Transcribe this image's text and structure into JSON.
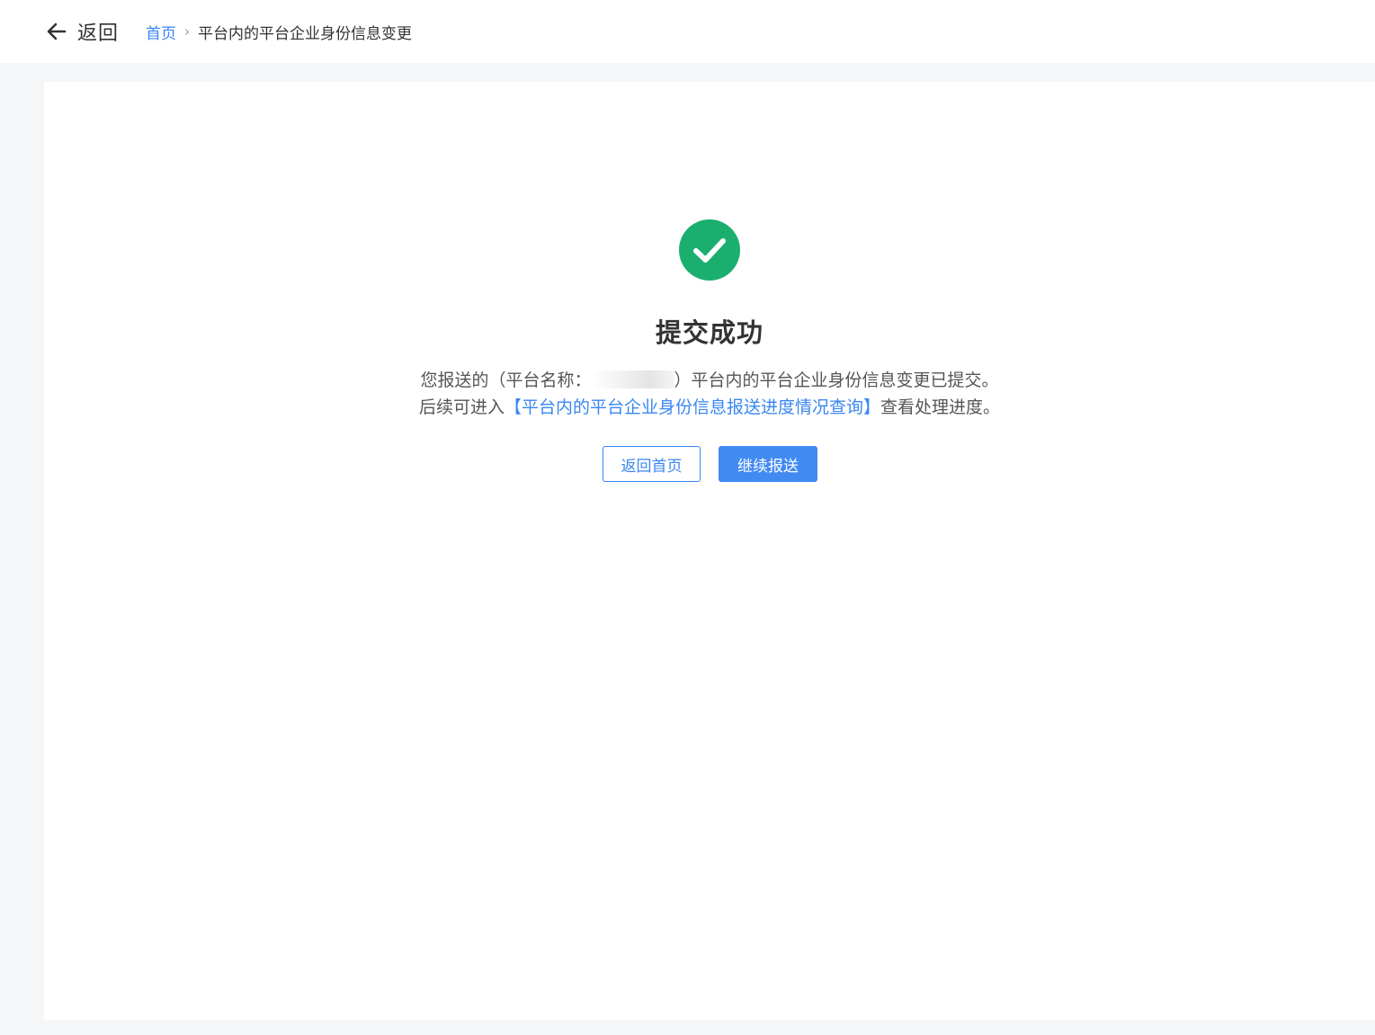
{
  "header": {
    "back_icon": "arrow-left-icon",
    "back_label": "返回",
    "breadcrumb": {
      "home": "首页",
      "separator_icon": "chevron-right-icon",
      "separator": "›",
      "current": "平台内的平台企业身份信息变更"
    }
  },
  "result": {
    "status_icon": "check-circle-icon",
    "status_color": "#1aaf6e",
    "title": "提交成功",
    "line1_prefix": "您报送的（平台名称：",
    "line1_suffix": "）平台内的平台企业身份信息变更已提交。",
    "line2_prefix": "后续可进入",
    "line2_link": "【平台内的平台企业身份信息报送进度情况查询】",
    "line2_suffix": "查看处理进度。"
  },
  "actions": {
    "back_home": "返回首页",
    "continue": "继续报送"
  },
  "colors": {
    "accent": "#3a86f0",
    "primary_button": "#418af2",
    "page_background": "#f5f6f8",
    "success": "#1aaf6e"
  }
}
